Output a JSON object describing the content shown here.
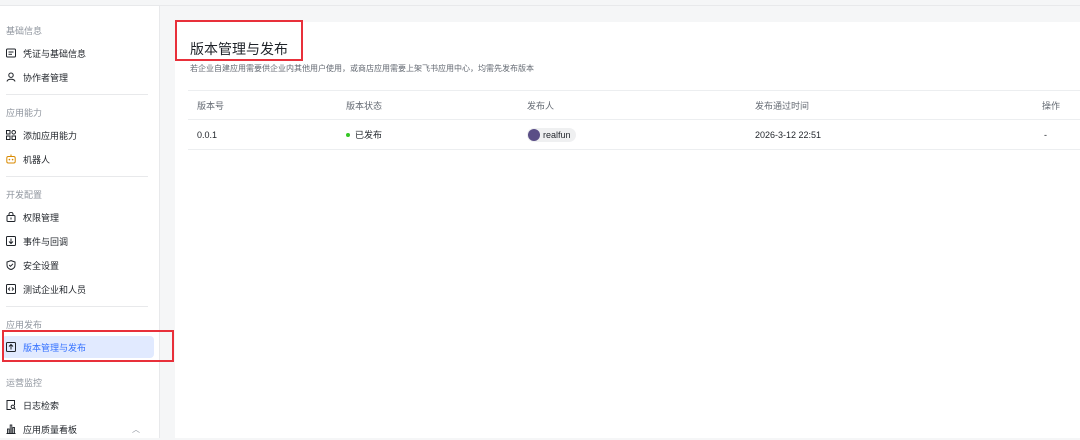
{
  "sidebar": {
    "sections": [
      {
        "title": "基础信息",
        "items": [
          {
            "label": "凭证与基础信息",
            "icon": "credential-icon"
          },
          {
            "label": "协作者管理",
            "icon": "person-icon"
          }
        ]
      },
      {
        "title": "应用能力",
        "items": [
          {
            "label": "添加应用能力",
            "icon": "grid-icon"
          },
          {
            "label": "机器人",
            "icon": "robot-icon"
          }
        ]
      },
      {
        "title": "开发配置",
        "items": [
          {
            "label": "权限管理",
            "icon": "lock-icon"
          },
          {
            "label": "事件与回调",
            "icon": "event-icon"
          },
          {
            "label": "安全设置",
            "icon": "shield-icon"
          },
          {
            "label": "测试企业和人员",
            "icon": "test-icon"
          }
        ]
      },
      {
        "title": "应用发布",
        "items": [
          {
            "label": "版本管理与发布",
            "icon": "upload-icon",
            "active": true
          }
        ]
      },
      {
        "title": "运营监控",
        "items": [
          {
            "label": "日志检索",
            "icon": "log-search-icon"
          },
          {
            "label": "应用质量看板",
            "icon": "chart-icon"
          }
        ]
      }
    ]
  },
  "main": {
    "title": "版本管理与发布",
    "description": "若企业自建应用需要供企业内其他用户使用，或商店应用需要上架飞书应用中心，均需先发布版本",
    "columns": [
      "版本号",
      "版本状态",
      "发布人",
      "发布通过时间",
      "操作"
    ],
    "rows": [
      {
        "version": "0.0.1",
        "status": "已发布",
        "publisher": "realfun",
        "time": "2026-3-12 22:51",
        "action": "-"
      }
    ]
  },
  "colors": {
    "accent": "#3370ff",
    "status_published": "#34c724",
    "highlight": "#e8303a"
  }
}
